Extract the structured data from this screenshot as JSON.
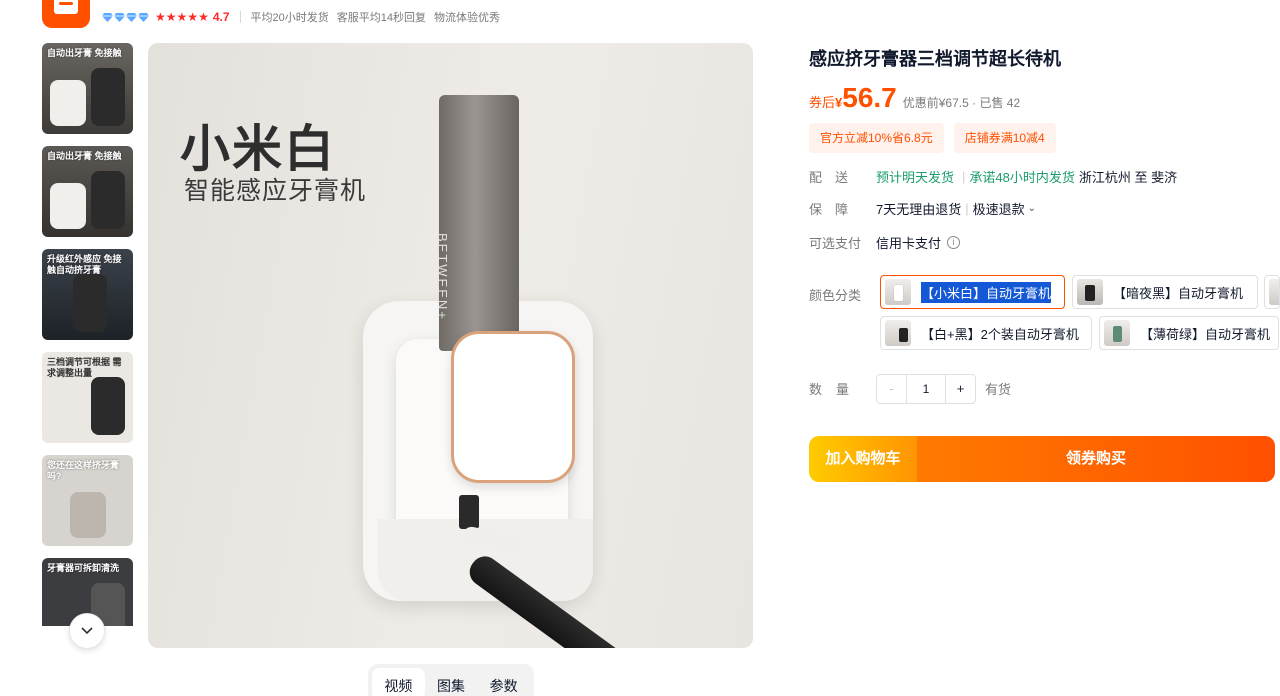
{
  "shop": {
    "diamond_count": 4,
    "star_count": 5,
    "score": "4.7",
    "stats": [
      "平均20小时发货",
      "客服平均14秒回复",
      "物流体验优秀"
    ],
    "colors": {
      "brand": "#ff5000",
      "diamond": "#5aa7ff",
      "star": "#ff2a2a"
    }
  },
  "thumbnails": [
    {
      "caption": "自动出牙膏 免接触",
      "icons": "white-and-black-dispenser"
    },
    {
      "caption": "自动出牙膏 免接触",
      "icons": "white-and-black-dispenser"
    },
    {
      "caption": "升级红外感应 免接触自动挤牙膏",
      "icons": "black-dispenser"
    },
    {
      "caption": "三档调节可根据 需求调整出量",
      "icons": "black-dispenser-levels"
    },
    {
      "caption": "您还在这样挤牙膏吗?",
      "icons": "hand-squeezing-tube"
    },
    {
      "caption": "牙膏器可拆卸清洗",
      "icons": "disassembled-dispenser"
    }
  ],
  "main_image": {
    "headline": "小米白",
    "subheadline": "智能感应牙膏机",
    "tube_text": "BETWEEN+"
  },
  "media_tabs": {
    "video": "视频",
    "gallery": "图集",
    "params": "参数"
  },
  "product": {
    "title": "感应挤牙膏器三档调节超长待机",
    "price_tag": "券后",
    "currency": "¥",
    "price": "56.7",
    "original": "优惠前¥67.5 · 已售 42"
  },
  "coupons": [
    "官方立减10%省6.8元",
    "店铺券满10减4"
  ],
  "delivery": {
    "label": "配　送",
    "eta": "预计明天发货",
    "promise": "承诺48小时内发货",
    "route": "浙江杭州 至 斐济"
  },
  "guarantee": {
    "label": "保　障",
    "items": [
      "7天无理由退货",
      "极速退款"
    ]
  },
  "payment": {
    "label": "可选支付",
    "method": "信用卡支付"
  },
  "sku": {
    "label": "颜色分类",
    "options": [
      "【小米白】自动牙膏机",
      "【暗夜黑】自动牙膏机",
      "",
      "【白+黑】2个装自动牙膏机",
      "【薄荷绿】自动牙膏机"
    ]
  },
  "quantity": {
    "label": "数量",
    "minus": "-",
    "value": "1",
    "plus": "+",
    "stock": "有货"
  },
  "actions": {
    "add_to_cart": "加入购物车",
    "buy": "领券购买"
  }
}
